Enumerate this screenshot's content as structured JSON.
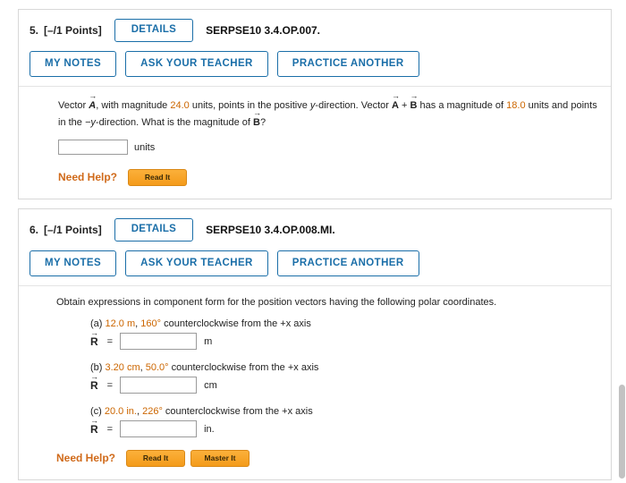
{
  "problems": [
    {
      "number": "5.",
      "points": "[–/1 Points]",
      "details_label": "DETAILS",
      "code": "SERPSE10 3.4.OP.007.",
      "buttons": [
        "MY NOTES",
        "ASK YOUR TEACHER",
        "PRACTICE ANOTHER"
      ],
      "question": {
        "seg1": "Vector ",
        "vecA": "A",
        "seg2": ", with magnitude ",
        "mag1": "24.0",
        "seg3": " units, points in the positive ",
        "axis1": "y",
        "seg4": "-direction. Vector ",
        "vecAB_a": "A",
        "plus": " + ",
        "vecAB_b": "B",
        "seg5": " has a magnitude of ",
        "mag2": "18.0",
        "seg6": " units and points in the ",
        "axis2": "−y",
        "seg7": "-direction. What is the magnitude of ",
        "vecB": "B",
        "seg8": "?"
      },
      "answer_unit": "units",
      "need_help_label": "Need Help?",
      "help_buttons": [
        "Read It"
      ]
    },
    {
      "number": "6.",
      "points": "[–/1 Points]",
      "details_label": "DETAILS",
      "code": "SERPSE10 3.4.OP.008.MI.",
      "buttons": [
        "MY NOTES",
        "ASK YOUR TEACHER",
        "PRACTICE ANOTHER"
      ],
      "intro": "Obtain expressions in component form for the position vectors having the following polar coordinates.",
      "parts": [
        {
          "tag": "(a) ",
          "value": "12.0 m",
          "comma": ", ",
          "angle": "160°",
          "rest": " counterclockwise from the +x axis",
          "vec_label": "R",
          "equals": "=",
          "unit": "m"
        },
        {
          "tag": "(b) ",
          "value": "3.20 cm",
          "comma": ", ",
          "angle": "50.0°",
          "rest": " counterclockwise from the +x axis",
          "vec_label": "R",
          "equals": "=",
          "unit": "cm"
        },
        {
          "tag": "(c) ",
          "value": "20.0 in.",
          "comma": ", ",
          "angle": "226°",
          "rest": " counterclockwise from the +x axis",
          "vec_label": "R",
          "equals": "=",
          "unit": "in."
        }
      ],
      "need_help_label": "Need Help?",
      "help_buttons": [
        "Read It",
        "Master It"
      ]
    }
  ],
  "colors": {
    "accent_blue": "#1a6ea8",
    "orange_value": "#cc6600",
    "need_help_orange": "#d06a1a"
  }
}
